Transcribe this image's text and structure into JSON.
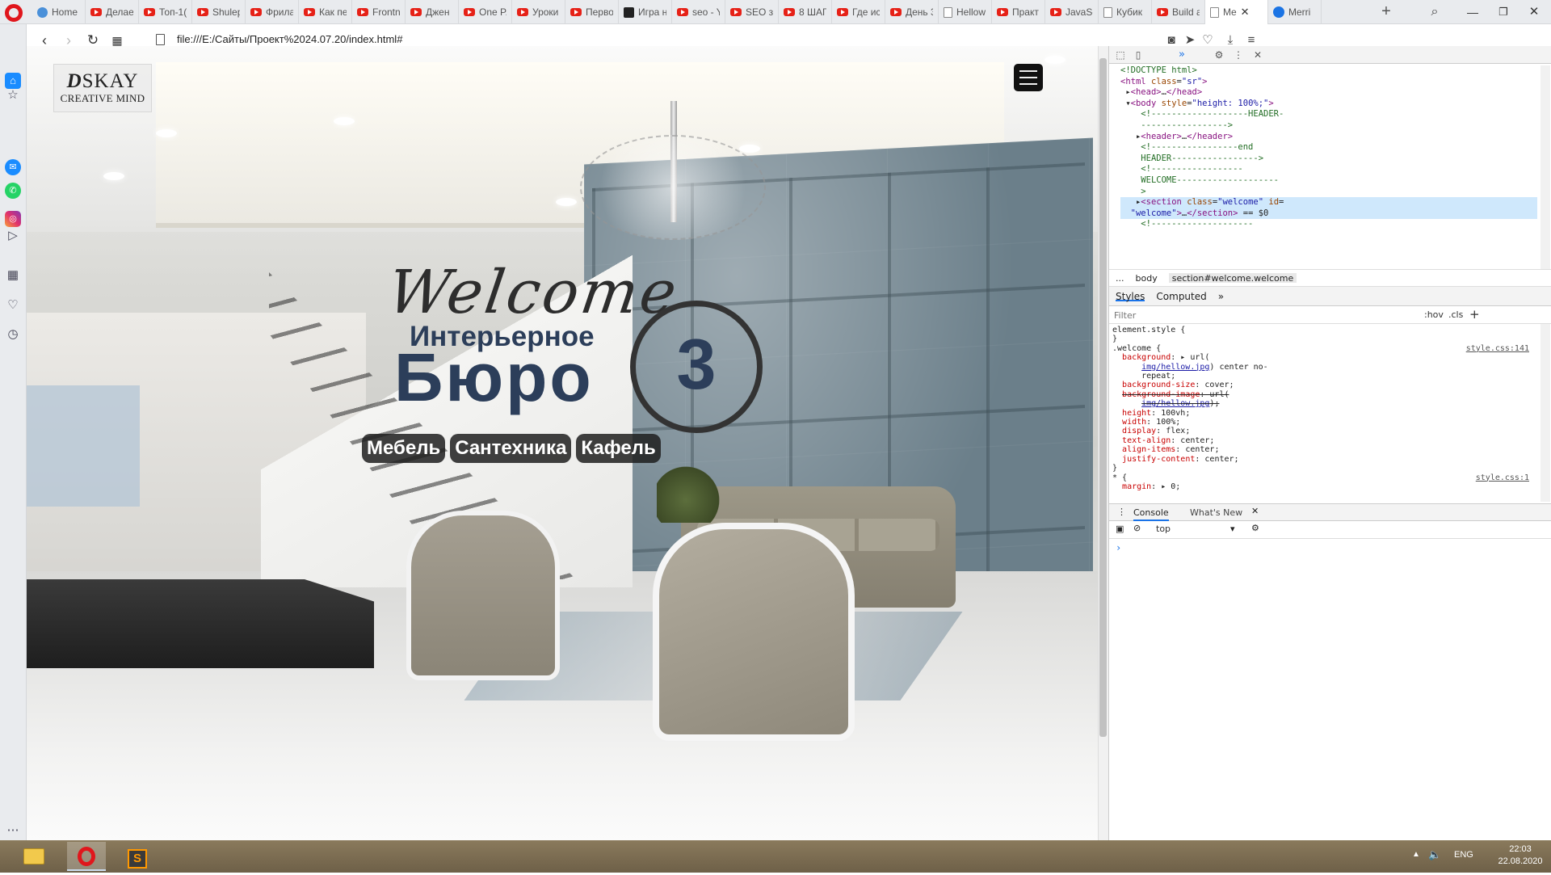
{
  "browser": {
    "tabs": [
      {
        "title": "Home",
        "icon": "home-icon"
      },
      {
        "title": "Делае",
        "icon": "youtube-icon"
      },
      {
        "title": "Топ-1(",
        "icon": "youtube-icon"
      },
      {
        "title": "Shulep",
        "icon": "youtube-icon"
      },
      {
        "title": "Фрила",
        "icon": "youtube-icon"
      },
      {
        "title": "Как пе",
        "icon": "youtube-icon"
      },
      {
        "title": "Frontn",
        "icon": "youtube-icon"
      },
      {
        "title": "Джен",
        "icon": "youtube-icon"
      },
      {
        "title": "One P.",
        "icon": "youtube-icon"
      },
      {
        "title": "Уроки",
        "icon": "youtube-icon"
      },
      {
        "title": "Перво",
        "icon": "youtube-icon"
      },
      {
        "title": "Игра н",
        "icon": "game-icon"
      },
      {
        "title": "seo - Y",
        "icon": "youtube-icon"
      },
      {
        "title": "SEO за",
        "icon": "youtube-icon"
      },
      {
        "title": "8 ШАГ",
        "icon": "youtube-icon"
      },
      {
        "title": "Где ис",
        "icon": "youtube-icon"
      },
      {
        "title": "День 3",
        "icon": "youtube-icon"
      },
      {
        "title": "Hellow",
        "icon": "document-icon"
      },
      {
        "title": "Практ",
        "icon": "youtube-icon"
      },
      {
        "title": "JavaSc",
        "icon": "youtube-icon"
      },
      {
        "title": "Кубик",
        "icon": "document-icon"
      },
      {
        "title": "Build a",
        "icon": "youtube-icon"
      },
      {
        "title": "Me",
        "icon": "document-icon",
        "active": true
      },
      {
        "title": "Merri",
        "icon": "facebook-icon"
      }
    ],
    "new_tab": "+",
    "url": "file:///E:/Сайты/Проект%2024.07.20/index.html#"
  },
  "site": {
    "logo_main": "SKAY",
    "logo_d": "D",
    "logo_sub": "CREATIVE MIND",
    "welcome": "Welcome",
    "subtitle": "Интерьерное",
    "big_title": "Бюро",
    "badge_number": "3",
    "tags": [
      "Мебель",
      "Сантехника",
      "Кафель"
    ]
  },
  "devtools": {
    "panel_tab": "»",
    "dom_lines": [
      {
        "html": "<span class='cmt'>&lt;!DOCTYPE html&gt;</span>"
      },
      {
        "html": "<span class='tag-c'>&lt;html</span> <span class='attr-n'>class</span>=<span class='attr-v'>\"sr\"</span><span class='tag-c'>&gt;</span>"
      },
      {
        "html": "&nbsp;▸<span class='tag-c'>&lt;head&gt;</span>…<span class='tag-c'>&lt;/head&gt;</span>"
      },
      {
        "html": "&nbsp;▾<span class='tag-c'>&lt;body</span> <span class='attr-n'>style</span>=<span class='attr-v'>\"height: 100%;\"</span><span class='tag-c'>&gt;</span>"
      },
      {
        "html": "&nbsp;&nbsp;&nbsp;&nbsp;<span class='cmt'>&lt;!-------------------HEADER-</span>"
      },
      {
        "html": "&nbsp;&nbsp;&nbsp;&nbsp;<span class='cmt'>-----------------&gt;</span>"
      },
      {
        "html": "&nbsp;&nbsp;&nbsp;▸<span class='tag-c'>&lt;header&gt;</span>…<span class='tag-c'>&lt;/header&gt;</span>"
      },
      {
        "html": "&nbsp;&nbsp;&nbsp;&nbsp;<span class='cmt'>&lt;!-----------------end</span>"
      },
      {
        "html": "&nbsp;&nbsp;&nbsp;&nbsp;<span class='cmt'>HEADER-----------------&gt;</span>"
      },
      {
        "html": "&nbsp;&nbsp;&nbsp;&nbsp;<span class='cmt'>&lt;!------------------</span>"
      },
      {
        "html": "&nbsp;&nbsp;&nbsp;&nbsp;<span class='cmt'>WELCOME--------------------</span>"
      },
      {
        "html": "&nbsp;&nbsp;&nbsp;&nbsp;<span class='cmt'>&gt;</span>"
      },
      {
        "html": "&nbsp;&nbsp;&nbsp;▸<span class='tag-c'>&lt;section</span> <span class='attr-n'>class</span>=<span class='attr-v'>\"welcome\"</span> <span class='attr-n'>id</span>=",
        "selected": true
      },
      {
        "html": "&nbsp;&nbsp;<span class='attr-v'>\"welcome\"</span><span class='tag-c'>&gt;</span>…<span class='tag-c'>&lt;/section&gt;</span> == $0",
        "selected": true
      },
      {
        "html": "&nbsp;&nbsp;&nbsp;&nbsp;<span class='cmt'>&lt;!--------------------</span>"
      }
    ],
    "breadcrumb": [
      "...",
      "body",
      "section#welcome.welcome"
    ],
    "style_tabs": [
      "Styles",
      "Computed",
      "»"
    ],
    "filter_placeholder": "Filter",
    "hov": ":hov",
    "cls": ".cls",
    "css_lines": [
      {
        "html": "element.style {"
      },
      {
        "html": "}"
      },
      {
        "html": ".welcome {<span class='css-src'>style.css:141</span>"
      },
      {
        "html": "&nbsp;&nbsp;<span class='css-prop'>background</span>: ▸ url("
      },
      {
        "html": "&nbsp;&nbsp;&nbsp;&nbsp;&nbsp;&nbsp;<span class='css-link'>img/hellow.jpg</span>) center no-"
      },
      {
        "html": "&nbsp;&nbsp;&nbsp;&nbsp;&nbsp;&nbsp;repeat;"
      },
      {
        "html": "&nbsp;&nbsp;<span class='css-prop'>background-size</span>: cover;"
      },
      {
        "html": "&nbsp;&nbsp;<span class='css-strike'><span class='css-prop'>background-image</span>: url(</span>"
      },
      {
        "html": "&nbsp;&nbsp;&nbsp;&nbsp;&nbsp;&nbsp;<span class='css-strike'><span class='css-link'>img/hellow.jpg</span>);</span>"
      },
      {
        "html": "&nbsp;&nbsp;<span class='css-prop'>height</span>: 100vh;"
      },
      {
        "html": "&nbsp;&nbsp;<span class='css-prop'>width</span>: 100%;"
      },
      {
        "html": "&nbsp;&nbsp;<span class='css-prop'>display</span>: flex;"
      },
      {
        "html": "&nbsp;&nbsp;<span class='css-prop'>text-align</span>: center;"
      },
      {
        "html": "&nbsp;&nbsp;<span class='css-prop'>align-items</span>: center;"
      },
      {
        "html": "&nbsp;&nbsp;<span class='css-prop'>justify-content</span>: center;"
      },
      {
        "html": "}"
      },
      {
        "html": "* {<span class='css-src'>style.css:1</span>"
      },
      {
        "html": "&nbsp;&nbsp;<span class='css-prop'>margin</span>: ▸ 0;"
      }
    ],
    "drawer_tabs": [
      "Console",
      "What's New"
    ],
    "context": "top",
    "prompt": "›"
  },
  "taskbar": {
    "lang": "ENG",
    "time": "22:03",
    "date": "22.08.2020"
  }
}
